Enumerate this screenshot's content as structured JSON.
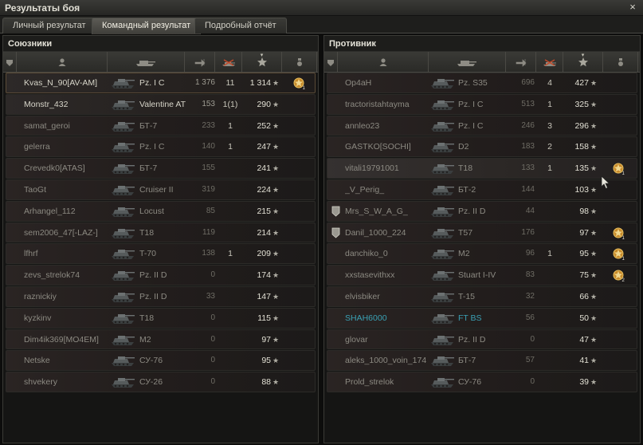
{
  "window": {
    "title": "Результаты боя",
    "close_glyph": "×"
  },
  "tabs": [
    {
      "label": "Личный результат",
      "active": false
    },
    {
      "label": "Командный результат",
      "active": true
    },
    {
      "label": "Подробный отчёт",
      "active": false
    }
  ],
  "columns": [
    {
      "icon": "squad-icon"
    },
    {
      "icon": "player-icon"
    },
    {
      "icon": "tank-icon"
    },
    {
      "icon": "damage-icon"
    },
    {
      "icon": "kills-icon"
    },
    {
      "icon": "xp-star-icon",
      "sorted": true
    },
    {
      "icon": "medal-icon"
    }
  ],
  "colors": {
    "squad": "#3aa0b4",
    "player_row": "#4a3c2c"
  },
  "allies": {
    "title": "Союзники",
    "rows": [
      {
        "name": "Kvas_N_90[AV-AM]",
        "tank": "Pz. I C",
        "damage": "1 376",
        "kills": "11",
        "xp": "1 314",
        "medal": "1",
        "player": true,
        "alive": true
      },
      {
        "name": "Monstr_432",
        "tank": "Valentine AT",
        "damage": "153",
        "kills": "1(1)",
        "xp": "290",
        "alive": true
      },
      {
        "name": "samat_geroi",
        "tank": "БТ-7",
        "damage": "233",
        "kills": "1",
        "xp": "252"
      },
      {
        "name": "gelerra",
        "tank": "Pz. I C",
        "damage": "140",
        "kills": "1",
        "xp": "247"
      },
      {
        "name": "Crevedk0[ATAS]",
        "tank": "БТ-7",
        "damage": "155",
        "kills": "",
        "xp": "241"
      },
      {
        "name": "TaoGt",
        "tank": "Cruiser II",
        "damage": "319",
        "kills": "",
        "xp": "224"
      },
      {
        "name": "Arhangel_112",
        "tank": "Locust",
        "damage": "85",
        "kills": "",
        "xp": "215"
      },
      {
        "name": "sem2006_47[-LAZ-]",
        "tank": "T18",
        "damage": "119",
        "kills": "",
        "xp": "214"
      },
      {
        "name": "lfhrf",
        "tank": "T-70",
        "damage": "138",
        "kills": "1",
        "xp": "209"
      },
      {
        "name": "zevs_strelok74",
        "tank": "Pz. II D",
        "damage": "0",
        "kills": "",
        "xp": "174"
      },
      {
        "name": "raznickiy",
        "tank": "Pz. II D",
        "damage": "33",
        "kills": "",
        "xp": "147"
      },
      {
        "name": "kyzkinv",
        "tank": "T18",
        "damage": "0",
        "kills": "",
        "xp": "115"
      },
      {
        "name": "Dim4ik369[MO4EM]",
        "tank": "M2",
        "damage": "0",
        "kills": "",
        "xp": "97"
      },
      {
        "name": "Netske",
        "tank": "СУ-76",
        "damage": "0",
        "kills": "",
        "xp": "95"
      },
      {
        "name": "shvekery",
        "tank": "СУ-26",
        "damage": "0",
        "kills": "",
        "xp": "88"
      }
    ]
  },
  "enemies": {
    "title": "Противник",
    "rows": [
      {
        "name": "Op4aH",
        "tank": "Pz. S35",
        "damage": "696",
        "kills": "4",
        "xp": "427"
      },
      {
        "name": "tractoristahtayma",
        "tank": "Pz. I C",
        "damage": "513",
        "kills": "1",
        "xp": "325"
      },
      {
        "name": "annleo23",
        "tank": "Pz. I C",
        "damage": "246",
        "kills": "3",
        "xp": "296"
      },
      {
        "name": "GASTKO[SOCHI]",
        "tank": "D2",
        "damage": "183",
        "kills": "2",
        "xp": "158"
      },
      {
        "name": "vitali19791001",
        "tank": "T18",
        "damage": "133",
        "kills": "1",
        "xp": "135",
        "medal": "1",
        "hover": true
      },
      {
        "name": "_V_Perig_",
        "tank": "БТ-2",
        "damage": "144",
        "kills": "",
        "xp": "103"
      },
      {
        "name": "Mrs_S_W_A_G_",
        "tank": "Pz. II D",
        "damage": "44",
        "kills": "",
        "xp": "98",
        "squad_icon": true
      },
      {
        "name": "Danil_1000_224",
        "tank": "T57",
        "damage": "176",
        "kills": "",
        "xp": "97",
        "medal": "1",
        "squad_icon": true
      },
      {
        "name": "danchiko_0",
        "tank": "M2",
        "damage": "96",
        "kills": "1",
        "xp": "95",
        "medal": "1"
      },
      {
        "name": "xxstasevithxx",
        "tank": "Stuart I-IV",
        "damage": "83",
        "kills": "",
        "xp": "75",
        "medal": "2"
      },
      {
        "name": "elvisbiker",
        "tank": "T-15",
        "damage": "32",
        "kills": "",
        "xp": "66"
      },
      {
        "name": "SHAH6000",
        "tank": "FT BS",
        "damage": "56",
        "kills": "",
        "xp": "50",
        "squad": true
      },
      {
        "name": "glovar",
        "tank": "Pz. II D",
        "damage": "0",
        "kills": "",
        "xp": "47"
      },
      {
        "name": "aleks_1000_voin_174",
        "tank": "БТ-7",
        "damage": "57",
        "kills": "",
        "xp": "41"
      },
      {
        "name": "Prold_strelok",
        "tank": "СУ-76",
        "damage": "0",
        "kills": "",
        "xp": "39"
      }
    ]
  },
  "star_glyph": "★"
}
